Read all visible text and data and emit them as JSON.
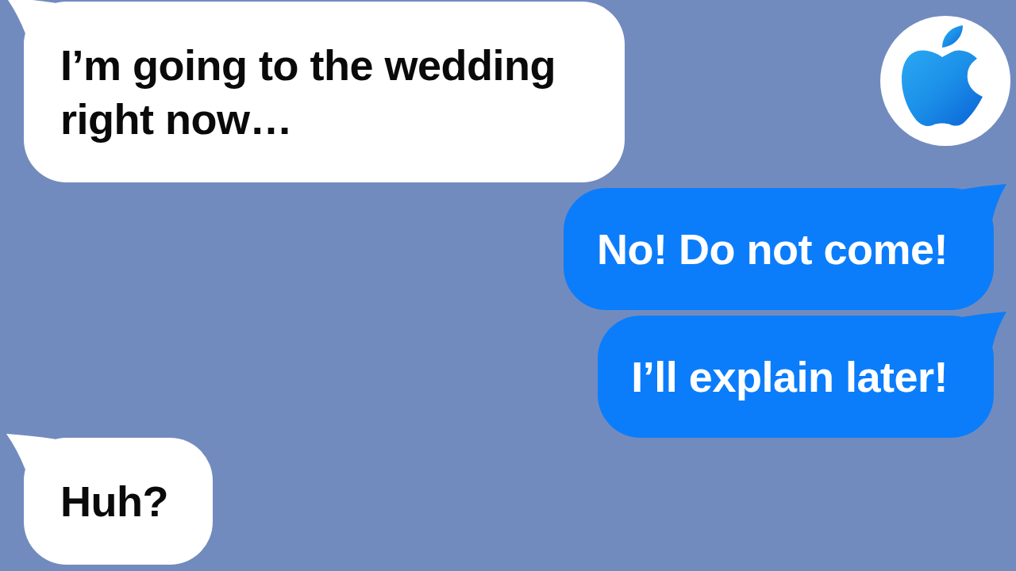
{
  "messages": [
    {
      "kind": "incoming",
      "text": "I’m going to the wedding right now…"
    },
    {
      "kind": "outgoing",
      "text": "No! Do not come!"
    },
    {
      "kind": "outgoing",
      "text": "I’ll explain later!"
    },
    {
      "kind": "incoming",
      "text": "Huh?"
    }
  ]
}
